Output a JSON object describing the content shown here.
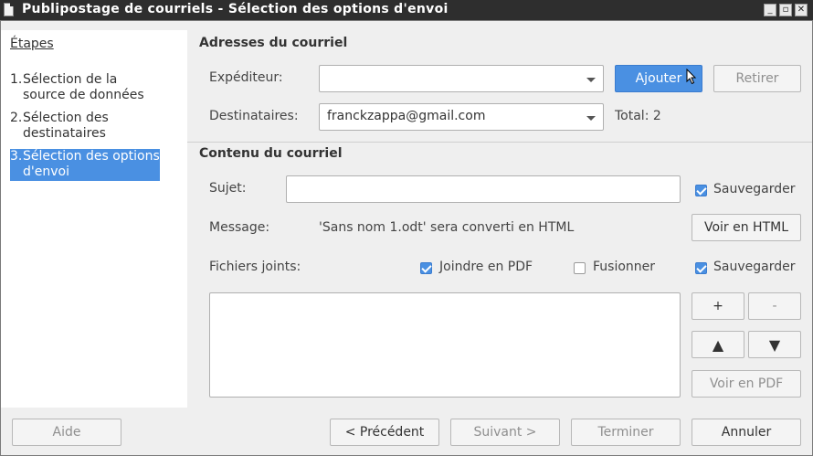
{
  "window": {
    "title": "Publipostage de courriels - Sélection des options d'envoi"
  },
  "sidebar": {
    "title": "Étapes",
    "steps": [
      {
        "num": "1.",
        "label": "Sélection de la source de données"
      },
      {
        "num": "2.",
        "label": "Sélection des destinataires"
      },
      {
        "num": "3.",
        "label": "Sélection des options d'envoi"
      }
    ]
  },
  "addresses": {
    "section_title": "Adresses du courriel",
    "sender_label": "Expéditeur:",
    "sender_value": "",
    "add_button": "Ajouter",
    "remove_button": "Retirer",
    "recipients_label": "Destinataires:",
    "recipients_value": "franckzappa@gmail.com",
    "total_label": "Total: 2"
  },
  "content": {
    "section_title": "Contenu du courriel",
    "subject_label": "Sujet:",
    "subject_value": "",
    "save_label": "Sauvegarder",
    "message_label": "Message:",
    "message_text": "'Sans nom 1.odt' sera converti en HTML",
    "view_html_button": "Voir en HTML",
    "attachments_label": "Fichiers joints:",
    "join_pdf_label": "Joindre en PDF",
    "merge_label": "Fusionner",
    "save_attach_label": "Sauvegarder",
    "plus_button": "+",
    "minus_button": "-",
    "up_button": "▲",
    "down_button": "▼",
    "view_pdf_button": "Voir en PDF"
  },
  "footer": {
    "help_button": "Aide",
    "prev_button": "< Précédent",
    "next_button": "Suivant >",
    "finish_button": "Terminer",
    "cancel_button": "Annuler"
  }
}
